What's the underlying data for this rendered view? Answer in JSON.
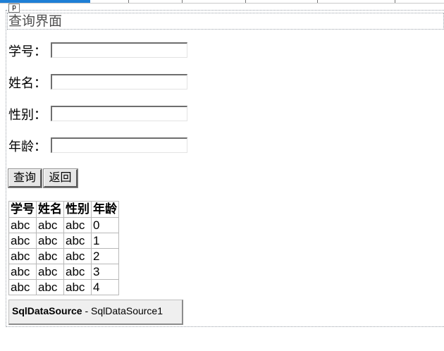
{
  "page": {
    "tag": "p",
    "title": "查询界面"
  },
  "form": {
    "fields": [
      {
        "label": "学号：",
        "value": ""
      },
      {
        "label": "姓名：",
        "value": ""
      },
      {
        "label": "性别：",
        "value": ""
      },
      {
        "label": "年龄：",
        "value": ""
      }
    ],
    "query_label": "查询",
    "back_label": "返回"
  },
  "grid": {
    "headers": [
      "学号",
      "姓名",
      "性别",
      "年龄"
    ],
    "rows": [
      [
        "abc",
        "abc",
        "abc",
        "0"
      ],
      [
        "abc",
        "abc",
        "abc",
        "1"
      ],
      [
        "abc",
        "abc",
        "abc",
        "2"
      ],
      [
        "abc",
        "abc",
        "abc",
        "3"
      ],
      [
        "abc",
        "abc",
        "abc",
        "4"
      ]
    ]
  },
  "datasource": {
    "type": "SqlDataSource",
    "separator": " - ",
    "id": "SqlDataSource1"
  },
  "colors": {
    "accent": "#1e7fd6",
    "control_bg": "#e6e6e6",
    "grid_border": "#b8b8b8"
  }
}
